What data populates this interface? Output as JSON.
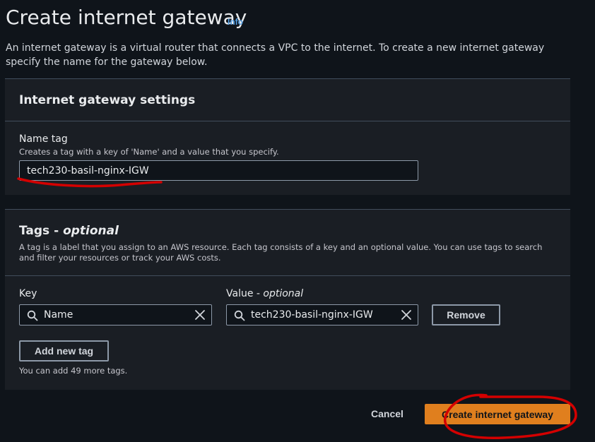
{
  "header": {
    "title": "Create internet gateway",
    "info_label": "Info",
    "description": "An internet gateway is a virtual router that connects a VPC to the internet. To create a new internet gateway specify the name for the gateway below."
  },
  "settings": {
    "title": "Internet gateway settings",
    "name_tag_label": "Name tag",
    "name_tag_description": "Creates a tag with a key of 'Name' and a value that you specify.",
    "name_tag_value": "tech230-basil-nginx-IGW"
  },
  "tags": {
    "title": "Tags - ",
    "title_optional": "optional",
    "description": "A tag is a label that you assign to an AWS resource. Each tag consists of a key and an optional value. You can use tags to search and filter your resources or track your AWS costs.",
    "key_label": "Key",
    "value_label": "Value - ",
    "value_label_optional": "optional",
    "rows": [
      {
        "key": "Name",
        "value": "tech230-basil-nginx-IGW"
      }
    ],
    "remove_label": "Remove",
    "add_label": "Add new tag",
    "remaining_note": "You can add 49 more tags."
  },
  "actions": {
    "cancel_label": "Cancel",
    "create_label": "Create internet gateway"
  },
  "colors": {
    "primary": "#e07f1e",
    "link": "#539fe5",
    "annotation": "#d40000"
  }
}
